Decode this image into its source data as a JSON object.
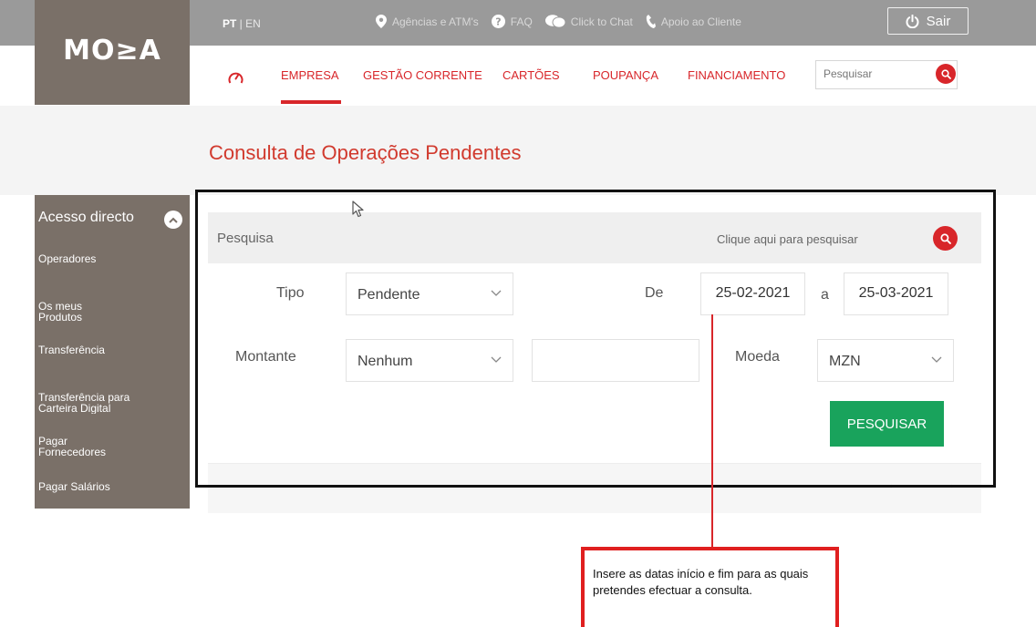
{
  "brand": {
    "logo_text": "MO≥A"
  },
  "topbar": {
    "lang_active": "PT",
    "lang_sep": " | ",
    "lang_other": "EN",
    "links": [
      {
        "icon": "location-pin-icon",
        "label": "Agências e ATM's"
      },
      {
        "icon": "question-icon",
        "label": "FAQ"
      },
      {
        "icon": "chat-bubbles-icon",
        "label": "Click to Chat"
      },
      {
        "icon": "phone-icon",
        "label": "Apoio ao Cliente"
      }
    ],
    "logout_label": "Sair"
  },
  "nav": {
    "items": [
      {
        "label": "EMPRESA",
        "active": true
      },
      {
        "label": "GESTÃO CORRENTE"
      },
      {
        "label": "CARTÕES"
      },
      {
        "label": "POUPANÇA"
      },
      {
        "label": "FINANCIAMENTO"
      }
    ],
    "search_placeholder": "Pesquisar"
  },
  "page": {
    "title": "Consulta de Operações Pendentes"
  },
  "sidebar": {
    "heading": "Acesso directo",
    "items": [
      {
        "label": "Operadores"
      },
      {
        "label": "Os meus Produtos"
      },
      {
        "label": "Transferência"
      },
      {
        "label": "Transferência para Carteira Digital"
      },
      {
        "label": "Pagar Fornecedores"
      },
      {
        "label": "Pagar Salários"
      }
    ]
  },
  "search_panel": {
    "title": "Pesquisa",
    "action_label": "Clique aqui para pesquisar",
    "tipo_label": "Tipo",
    "tipo_value": "Pendente",
    "de_label": "De",
    "date_from": "25-02-2021",
    "a_label": "a",
    "date_to": "25-03-2021",
    "montante_label": "Montante",
    "montante_value": "Nenhum",
    "montante_input": "",
    "moeda_label": "Moeda",
    "moeda_value": "MZN",
    "submit_label": "PESQUISAR",
    "pager_prev": "←",
    "pager_next": "→"
  },
  "annotation": {
    "text": "Insere as datas início e fim para as quais pretendes efectuar a consulta.",
    "color": "#e01f1f"
  },
  "colors": {
    "accent": "#d8262a",
    "brand": "#7a7068",
    "success": "#19a35c"
  }
}
